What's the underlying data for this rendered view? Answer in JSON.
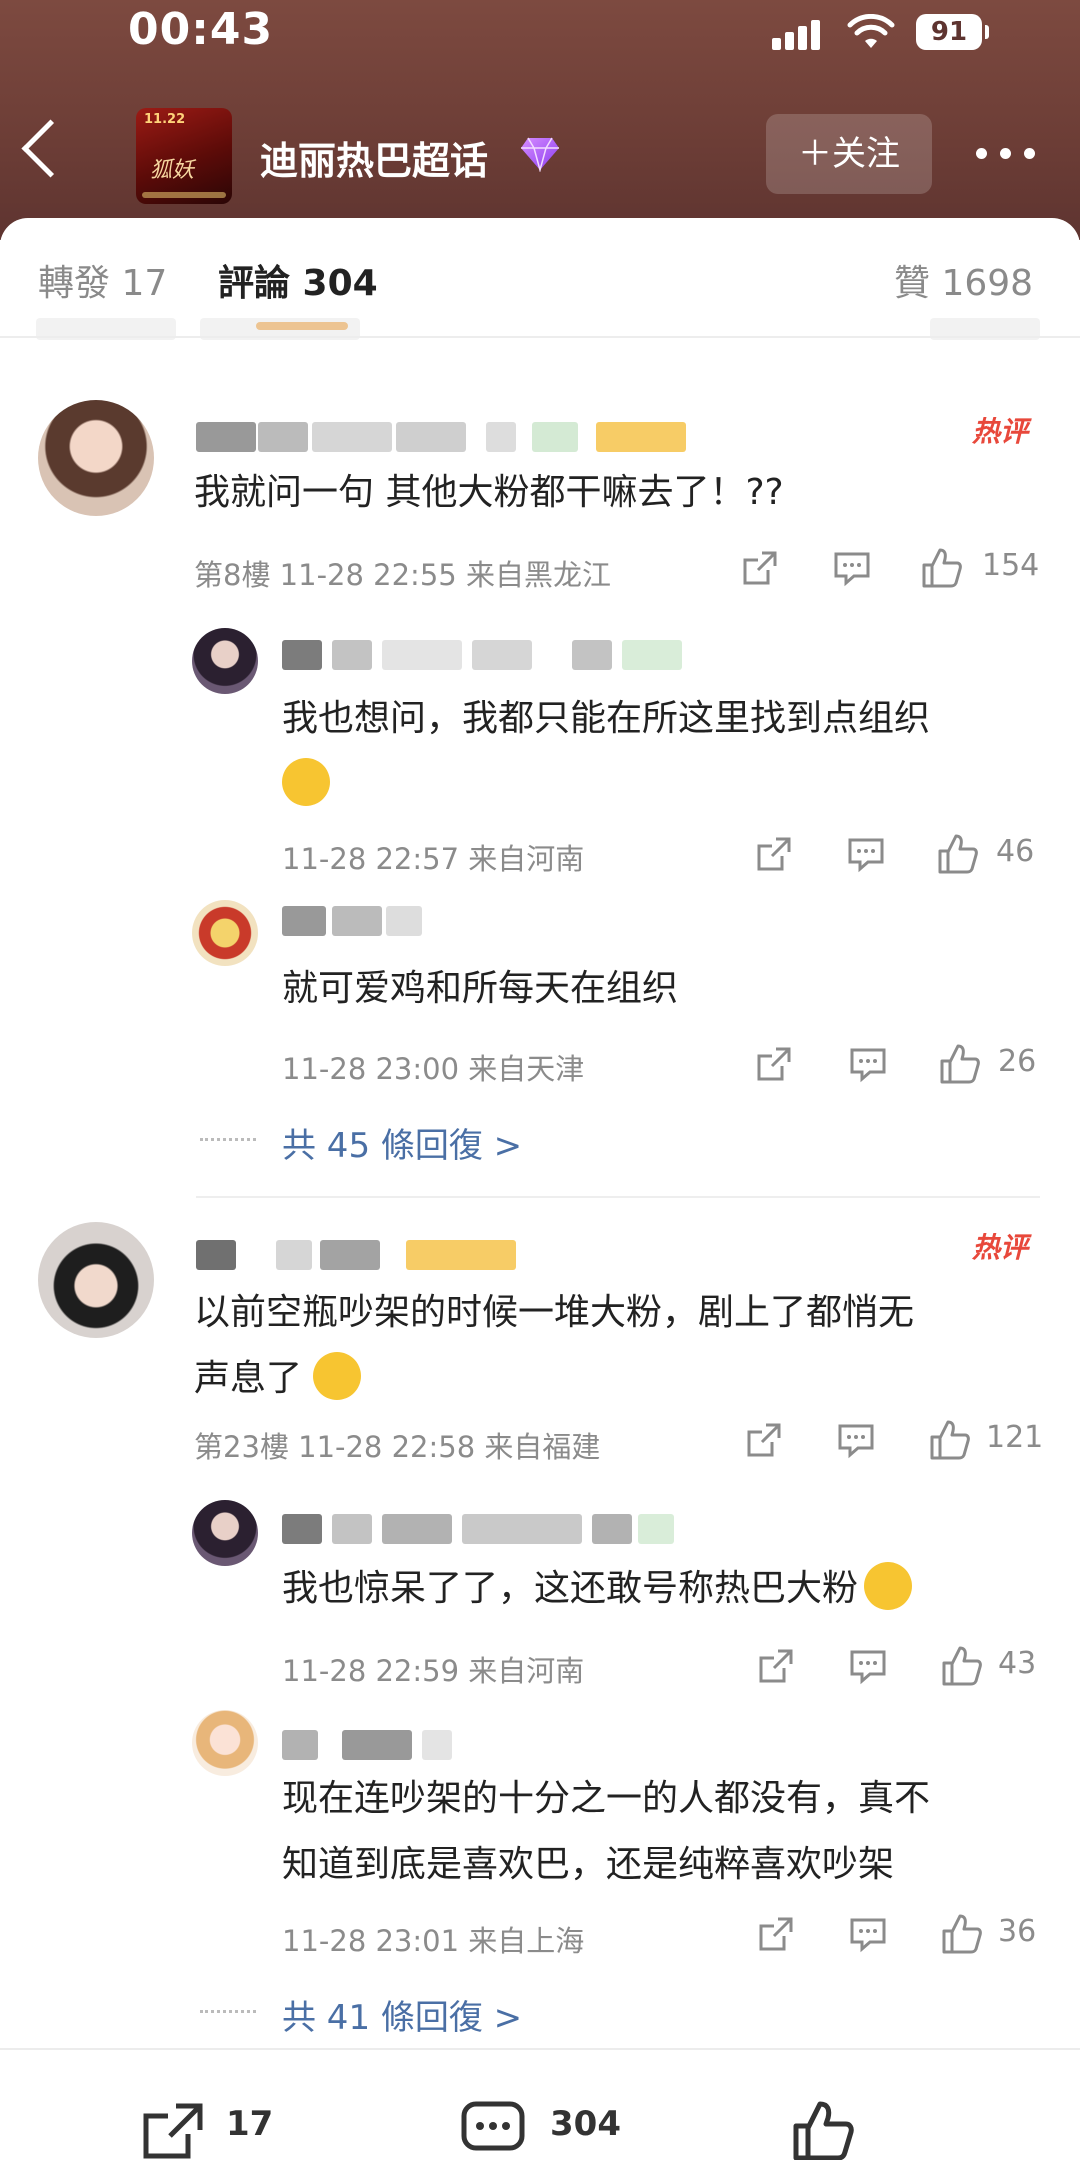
{
  "status_bar": {
    "time": "00:43",
    "battery": "91"
  },
  "header": {
    "topic_title": "迪丽热巴超话",
    "follow_label": "＋关注"
  },
  "tabs": [
    {
      "label": "轉發 17"
    },
    {
      "label": "評論 304"
    },
    {
      "label": "贊 1698"
    }
  ],
  "comments": [
    {
      "hot_badge": "热评",
      "text_lines": [
        "我就问一句 其他大粉都干嘛去了！??"
      ],
      "meta": "第8樓 11-28 22:55 来自黑龙江",
      "likes": "154",
      "replies": [
        {
          "text_lines": [
            "我也想问，我都只能在所这里找到点组织"
          ],
          "meta": "11-28 22:57 来自河南",
          "likes": "46"
        },
        {
          "text_lines": [
            "就可爱鸡和所每天在组织"
          ],
          "meta": "11-28 23:00 来自天津",
          "likes": "26"
        }
      ],
      "more_replies": "共 45 條回復 >"
    },
    {
      "hot_badge": "热评",
      "text_lines": [
        "以前空瓶吵架的时候一堆大粉，剧上了都悄无",
        "声息了"
      ],
      "meta": "第23樓 11-28 22:58 来自福建",
      "likes": "121",
      "replies": [
        {
          "text_lines": [
            "我也惊呆了了，这还敢号称热巴大粉"
          ],
          "meta": "11-28 22:59 来自河南",
          "likes": "43"
        },
        {
          "text_lines": [
            "现在连吵架的十分之一的人都没有，真不",
            "知道到底是喜欢巴，还是纯粹喜欢吵架"
          ],
          "meta": "11-28 23:01 来自上海",
          "likes": "36"
        }
      ],
      "more_replies": "共 41 條回復 >"
    }
  ],
  "bottom_bar": {
    "repost_count": "17",
    "comment_count": "304"
  },
  "colors": {
    "header_bg": "#6c3d36",
    "accent_orange": "#f39a2a",
    "hot_red": "#e8483b",
    "link_blue": "#4a6fa5"
  }
}
